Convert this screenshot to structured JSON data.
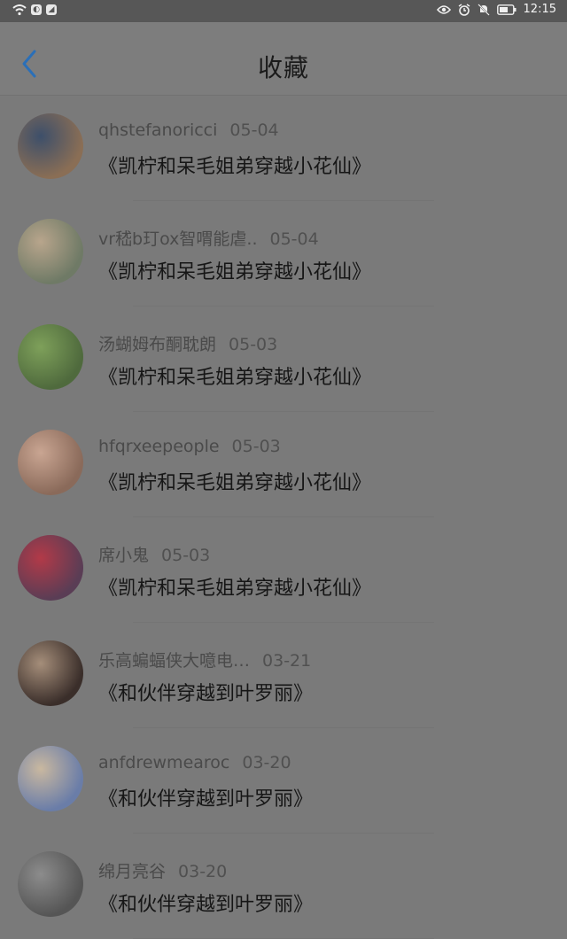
{
  "status_bar": {
    "left_icons": [
      "wifi-signal-icon",
      "app-badge-icon",
      "app-badge-icon"
    ],
    "right_icons": [
      "eye-icon",
      "alarm-icon",
      "silent-icon",
      "battery-icon"
    ],
    "time": "12:15"
  },
  "header": {
    "back_icon": "chevron-left-icon",
    "title": "收藏",
    "accent_color": "#2a6fb8"
  },
  "items": [
    {
      "user": "qhstefanoricci",
      "date": "05-04",
      "title": "《凯柠和呆毛姐弟穿越小花仙》",
      "avatar_colors": [
        "#8a6e55",
        "#3d4f6a"
      ]
    },
    {
      "user": "vr嵇b玎ox智喟能虐..",
      "date": "05-04",
      "title": "《凯柠和呆毛姐弟穿越小花仙》",
      "avatar_colors": [
        "#6f7a66",
        "#b8a58c"
      ]
    },
    {
      "user": "汤蝴姆布酮耽朗",
      "date": "05-03",
      "title": "《凯柠和呆毛姐弟穿越小花仙》",
      "avatar_colors": [
        "#4f6a3d",
        "#7ea05a"
      ]
    },
    {
      "user": "hfqrxeepeople",
      "date": "05-03",
      "title": "《凯柠和呆毛姐弟穿越小花仙》",
      "avatar_colors": [
        "#8a6a5a",
        "#c9a592"
      ]
    },
    {
      "user": "席小鬼",
      "date": "05-03",
      "title": "《凯柠和呆毛姐弟穿越小花仙》",
      "avatar_colors": [
        "#5a3d55",
        "#b23a48"
      ]
    },
    {
      "user": "乐高蝙蝠侠大噫电…",
      "date": "03-21",
      "title": "《和伙伴穿越到叶罗丽》",
      "avatar_colors": [
        "#3a2e2a",
        "#a58e7a"
      ]
    },
    {
      "user": "anfdrewmearoc",
      "date": "03-20",
      "title": "《和伙伴穿越到叶罗丽》",
      "avatar_colors": [
        "#6a7da8",
        "#c9b8a0"
      ]
    },
    {
      "user": "绵月亮谷",
      "date": "03-20",
      "title": "《和伙伴穿越到叶罗丽》",
      "avatar_colors": [
        "#555555",
        "#8c8c8c"
      ]
    }
  ]
}
